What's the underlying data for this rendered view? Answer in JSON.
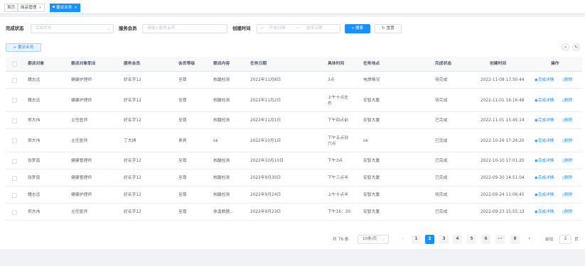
{
  "tabs": [
    {
      "label": "首页",
      "closable": false,
      "active": false
    },
    {
      "label": "商品管理",
      "closable": true,
      "active": false
    },
    {
      "label": "委派业务",
      "closable": true,
      "active": true
    }
  ],
  "filters": {
    "status_label": "完成状态",
    "status_placeholder": "完成状态",
    "member_label": "服务会员",
    "member_placeholder": "请输入服务会员",
    "time_label": "创建时间",
    "start_placeholder": "开始日期",
    "range_sep": "-",
    "end_placeholder": "结束日期",
    "search_label": "搜索",
    "reset_label": "重置"
  },
  "toolbar": {
    "add_label": "+ 委派业务"
  },
  "table": {
    "headers": [
      "委派对象",
      "委派对象职业",
      "服务会员",
      "会员等级",
      "委派内容",
      "任务日期",
      "具体时间",
      "任务地点",
      "完成状态",
      "创建时间",
      "操作"
    ],
    "detail_label": "完成详情",
    "delete_label": "删除",
    "rows": [
      [
        "魏志远",
        "健康护理师",
        "好名字12",
        "至尊",
        "核酸检测",
        "2022年11月8日",
        "3点",
        "电焊情况",
        "待完成",
        "2022-11-08 17:50:44"
      ],
      [
        "魏志远",
        "健康护理师",
        "好名字12",
        "至尊",
        "核酸检测",
        "2022年11月2日",
        "上午十点左右",
        "宏智大厦",
        "待完成",
        "2022-11-01 16:16:48"
      ],
      [
        "郑大伟",
        "主任医师",
        "好名字12",
        "至尊",
        "核酸检测",
        "2022年11月1日",
        "下午四点前",
        "宏智大厦",
        "已完成",
        "2022-11-01 15:45:14"
      ],
      [
        "郑大伟",
        "主任医师",
        "丁大琪",
        "贵宾",
        "ok",
        "2022年10月1日",
        "下午五点到六点",
        "ok",
        "已完成",
        "2022-10-26 17:24:20"
      ],
      [
        "张梦南",
        "健康管理师",
        "好名字12",
        "至尊",
        "核酸检测",
        "2022年10月10日",
        "下午3点",
        "宏智大厦",
        "已完成",
        "2022-10-10 17:01:20"
      ],
      [
        "张梦南",
        "健康管理师",
        "好名字12",
        "至尊",
        "核酸检测",
        "2022年9月30日",
        "下午三点半",
        "宏智大厦",
        "已完成",
        "2022-09-30 14:51:04"
      ],
      [
        "魏志远",
        "健康护理师",
        "好名字12",
        "至尊",
        "核酸检测",
        "2022年9月24日",
        "上午十点半",
        "宏智大厦",
        "待完成",
        "2022-09-24 11:06:45"
      ],
      [
        "郑大伟",
        "主任医师",
        "好名字12",
        "至尊",
        "体温数据...",
        "2022年9月23日",
        "下午16：30",
        "宏智大厦",
        "已完成",
        "2022-09-23 15:55:13"
      ]
    ]
  },
  "pagination": {
    "total_text": "共 76 条",
    "page_size": "10条/页",
    "prev": "‹",
    "pages": [
      "1",
      "2",
      "3",
      "4",
      "5",
      "6",
      "···",
      "8"
    ],
    "current_page": "2",
    "next": "›",
    "goto_label": "前往",
    "goto_value": "2",
    "goto_suffix": "页"
  },
  "colors": {
    "primary": "#1890ff",
    "header_bg": "#f8f8f9",
    "page_bg": "#f0f2f5"
  }
}
